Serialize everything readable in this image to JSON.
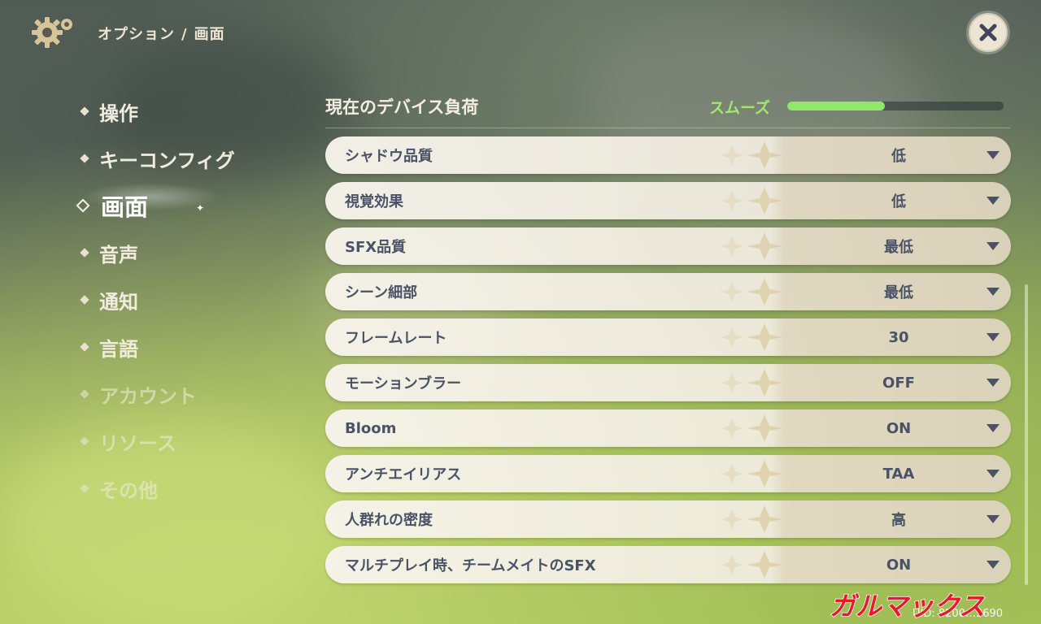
{
  "header": {
    "breadcrumb_parent": "オプション",
    "breadcrumb_sep": "/",
    "breadcrumb_current": "画面"
  },
  "sidebar": {
    "items": [
      {
        "label": "操作"
      },
      {
        "label": "キーコンフィグ"
      },
      {
        "label": "画面"
      },
      {
        "label": "音声"
      },
      {
        "label": "通知"
      },
      {
        "label": "言語"
      },
      {
        "label": "アカウント"
      },
      {
        "label": "リソース"
      },
      {
        "label": "その他"
      }
    ]
  },
  "device_load": {
    "label": "現在のデバイス負荷",
    "status": "スムーズ",
    "level": 0.45,
    "color": "#8fe86a"
  },
  "settings": [
    {
      "label": "シャドウ品質",
      "value": "低"
    },
    {
      "label": "視覚効果",
      "value": "低"
    },
    {
      "label": "SFX品質",
      "value": "最低"
    },
    {
      "label": "シーン細部",
      "value": "最低"
    },
    {
      "label": "フレームレート",
      "value": "30"
    },
    {
      "label": "モーションブラー",
      "value": "OFF"
    },
    {
      "label": "Bloom",
      "value": "ON"
    },
    {
      "label": "アンチエイリアス",
      "value": "TAA"
    },
    {
      "label": "人群れの密度",
      "value": "高"
    },
    {
      "label": "マルチプレイ時、チームメイトのSFX",
      "value": "ON"
    }
  ],
  "footer": {
    "uid": "UID: 8200…3690",
    "watermark": "ガルマックス"
  },
  "icons": {
    "settings": "gear-icon",
    "close": "close-icon",
    "dropdown": "chevron-down-icon"
  }
}
